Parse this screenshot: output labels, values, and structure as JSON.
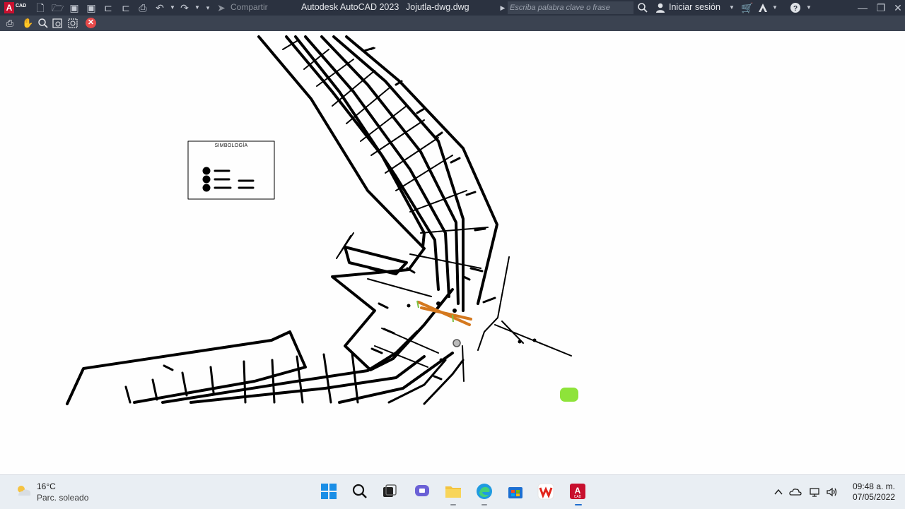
{
  "titlebar": {
    "app_badge": "A",
    "app_badge_sub": "CAD",
    "share_label": "Compartir",
    "app_title": "Autodesk AutoCAD 2023",
    "file_title": "Jojutla-dwg.dwg",
    "search_placeholder": "Escriba palabra clave o frase",
    "signin_label": "Iniciar sesión",
    "icons": [
      "new-file-icon",
      "open-folder-icon",
      "save-icon",
      "save-as-icon",
      "export-icon",
      "import-icon",
      "print-icon",
      "undo-icon",
      "redo-icon",
      "dropdown-icon",
      "share-icon",
      "search-icon",
      "user-icon",
      "cart-icon",
      "autodesk-a360-icon",
      "help-icon",
      "minimize-icon",
      "restore-icon",
      "close-icon"
    ]
  },
  "toolbar": {
    "icons": [
      "print-icon",
      "pan-icon",
      "zoom-icon",
      "zoom-window-icon",
      "zoom-extents-icon",
      "close-view-icon"
    ]
  },
  "drawing": {
    "legend_title": "SIMBOLOGÍA"
  },
  "taskbar": {
    "weather_temp": "16°C",
    "weather_desc": "Parc. soleado",
    "time": "09:48 a. m.",
    "date": "07/05/2022",
    "apps": [
      "start-icon",
      "search-icon",
      "task-view-icon",
      "teams-chat-icon",
      "file-explorer-icon",
      "edge-icon",
      "store-icon",
      "wps-office-icon",
      "autocad-icon"
    ],
    "tray_icons": [
      "chevron-up-icon",
      "onedrive-icon",
      "network-icon",
      "volume-icon"
    ]
  },
  "colors": {
    "titlebar": "#2b3240",
    "toolbar": "#3b4351",
    "canvas": "#fefefe",
    "taskbar": "#e9eef3",
    "accent_red": "#c8102e"
  }
}
